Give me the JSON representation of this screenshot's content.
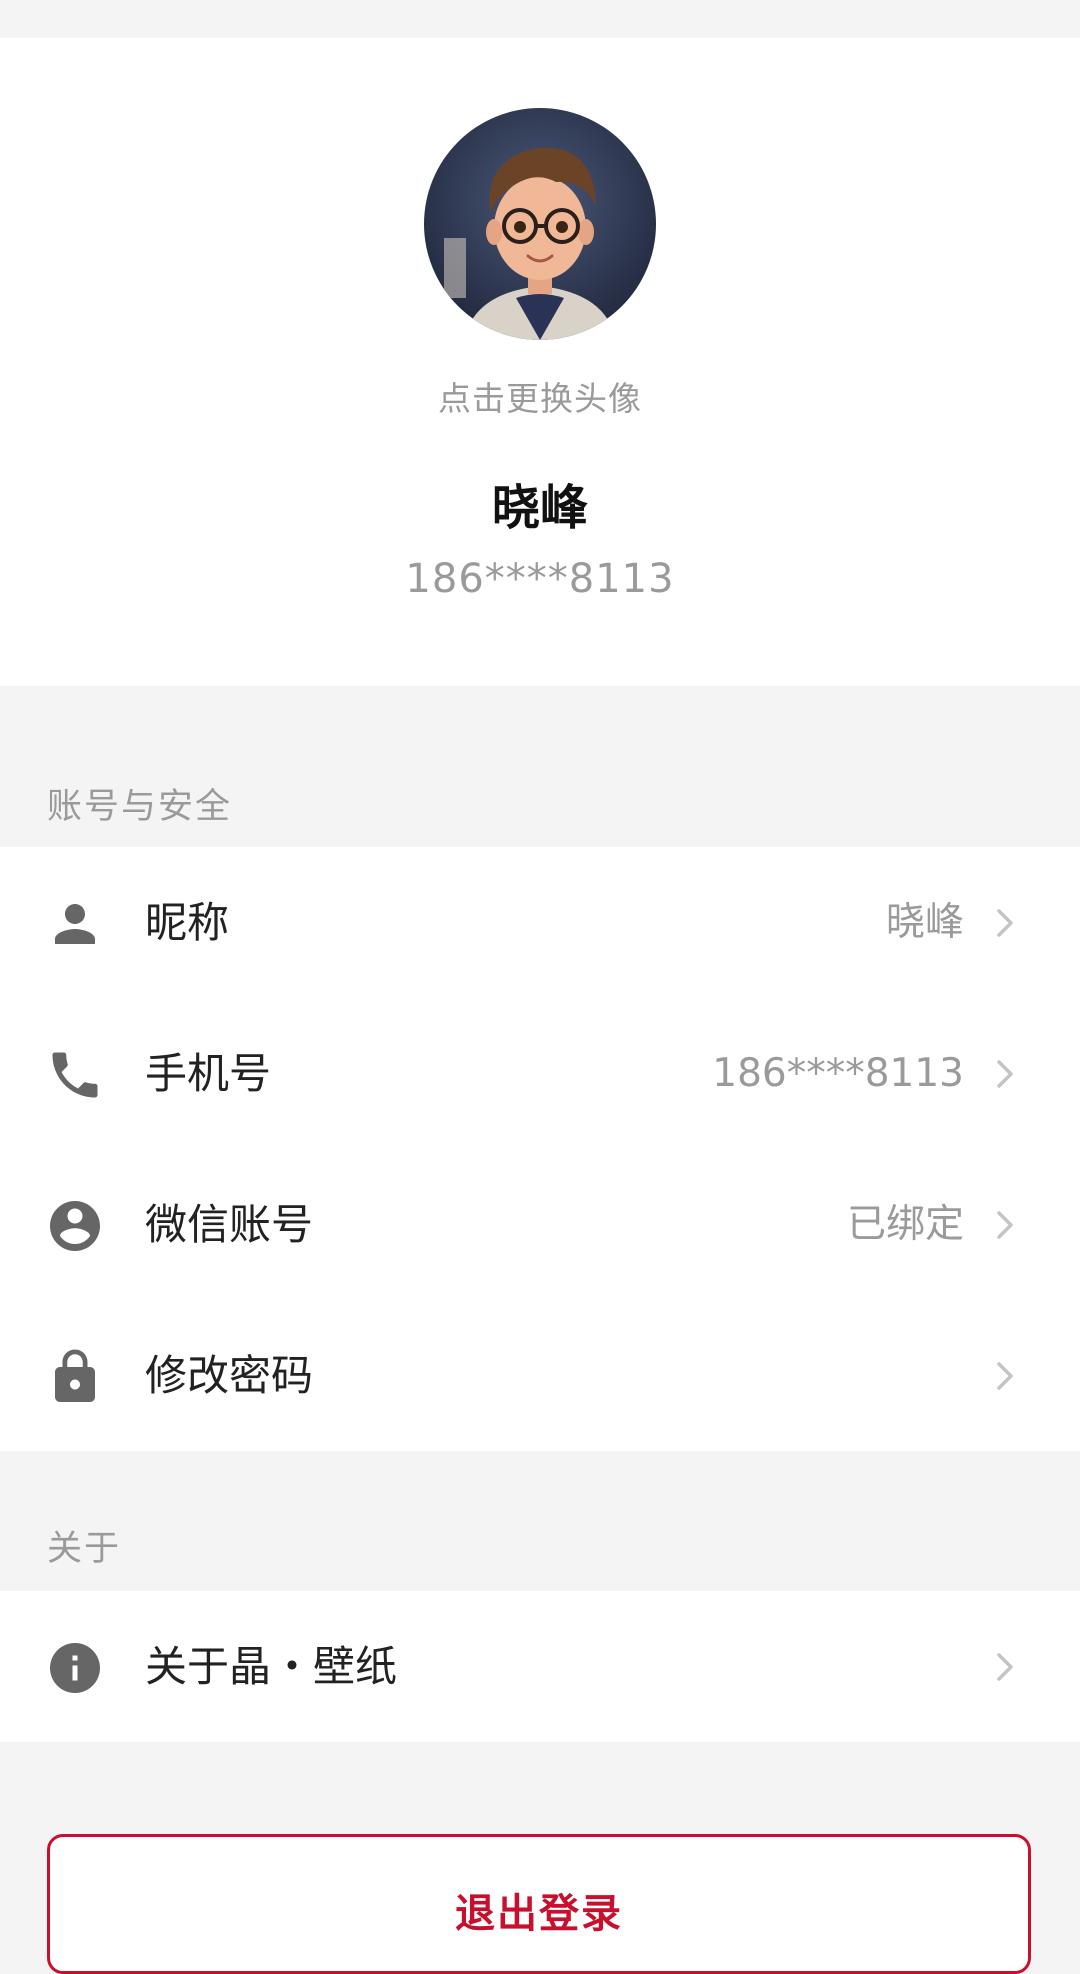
{
  "profile": {
    "avatar_hint": "点击更换头像",
    "name": "晓峰",
    "phone": "186****8113"
  },
  "sections": {
    "account_security": {
      "title": "账号与安全",
      "rows": [
        {
          "label": "昵称",
          "value": "晓峰",
          "icon": "person-icon"
        },
        {
          "label": "手机号",
          "value": "186****8113",
          "icon": "phone-icon"
        },
        {
          "label": "微信账号",
          "value": "已绑定",
          "icon": "account-circle-icon"
        },
        {
          "label": "修改密码",
          "value": "",
          "icon": "lock-icon"
        }
      ]
    },
    "about": {
      "title": "关于",
      "rows": [
        {
          "label": "关于晶・壁纸",
          "value": "",
          "icon": "info-icon"
        }
      ]
    }
  },
  "logout": {
    "label": "退出登录"
  },
  "colors": {
    "background": "#f4f4f4",
    "card": "#ffffff",
    "accent_red": "#c8102e",
    "secondary_text": "#9a9a9a",
    "icon_gray": "#666666"
  }
}
